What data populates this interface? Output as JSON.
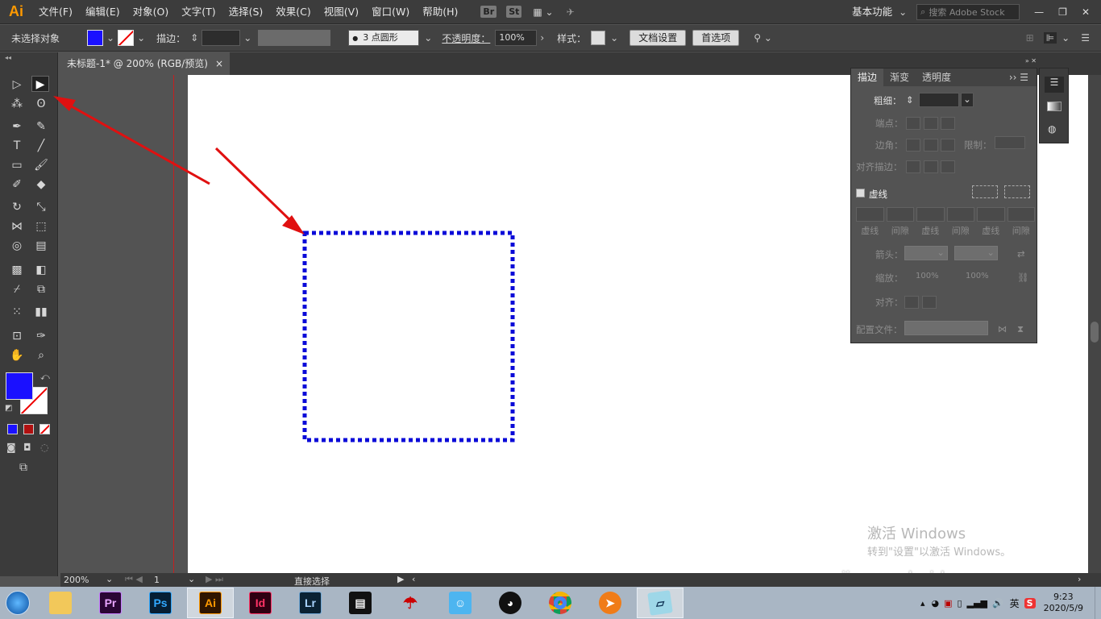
{
  "app": {
    "logo": "Ai",
    "menus": [
      "文件(F)",
      "编辑(E)",
      "对象(O)",
      "文字(T)",
      "选择(S)",
      "效果(C)",
      "视图(V)",
      "窗口(W)",
      "帮助(H)"
    ],
    "badges": [
      "Br",
      "St"
    ],
    "workspace": "基本功能",
    "search_placeholder": "搜索 Adobe Stock"
  },
  "control": {
    "no_selection": "未选择对象",
    "stroke_label": "描边：",
    "brush_value": "3 点圆形",
    "opacity_label": "不透明度：",
    "opacity_value": "100%",
    "style_label": "样式：",
    "doc_setup": "文档设置",
    "preferences": "首选项"
  },
  "document": {
    "tab_title": "未标题-1* @ 200% (RGB/预览)",
    "close": "×"
  },
  "colors": {
    "fill": "#1a10ff",
    "stroke_dash": "#0a0ad8",
    "arrow": "#e01010"
  },
  "stroke_panel": {
    "tabs": [
      "描边",
      "渐变",
      "透明度"
    ],
    "weight_label": "粗细：",
    "cap_label": "端点：",
    "corner_label": "边角：",
    "limit_label": "限制：",
    "align_label": "对齐描边：",
    "dashed_label": "虚线",
    "dash_headers": [
      "虚线",
      "间隙",
      "虚线",
      "间隙",
      "虚线",
      "间隙"
    ],
    "arrow_label": "箭头：",
    "scale_label": "缩放：",
    "scale_values": [
      "100%",
      "100%"
    ],
    "align2_label": "对齐：",
    "profile_label": "配置文件："
  },
  "status": {
    "zoom": "200%",
    "page": "1",
    "tool_name": "直接选择"
  },
  "watermark": {
    "line1": "激活 Windows",
    "line2": "转到\"设置\"以激活 Windows。",
    "site": "jingyan.baidu.com"
  },
  "taskbar": {
    "apps": [
      "Pr",
      "Ps",
      "Ai",
      "Id",
      "Lr"
    ],
    "time": "9:23",
    "date": "2020/5/9",
    "ime": "英"
  }
}
